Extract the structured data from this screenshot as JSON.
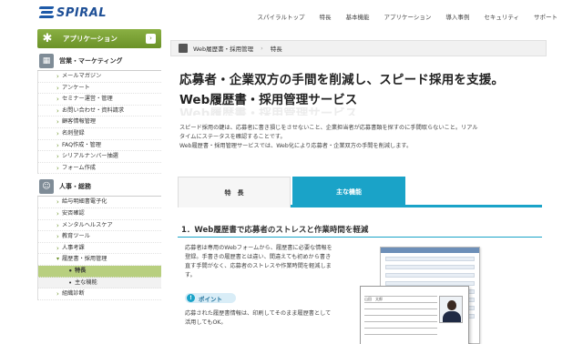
{
  "brand": {
    "name": "SPIRAL"
  },
  "topnav": [
    "スパイラルトップ",
    "特長",
    "基本機能",
    "アプリケーション",
    "導入事例",
    "セキュリティ",
    "サポート"
  ],
  "sidebar": {
    "app_title": "アプリケーション",
    "section1": {
      "title": "営業・マーケティング",
      "items": [
        "メールマガジン",
        "アンケート",
        "セミナー運営・管理",
        "お問い合わせ・資料請求",
        "顧客情報管理",
        "名刺登録",
        "FAQ作成・管理",
        "シリアルナンバー抽選",
        "フォーム作成"
      ]
    },
    "section2": {
      "title": "人事・総務",
      "items": [
        "給与明細書電子化",
        "安否確認",
        "メンタルヘルスケア",
        "教育ツール",
        "人事考課",
        "履歴書・採用管理"
      ],
      "subitems": [
        "特長",
        "主な機能"
      ],
      "after": [
        "組織診断"
      ]
    }
  },
  "breadcrumb": {
    "current": "Web履歴書・採用管理",
    "child": "特長"
  },
  "hero": {
    "line1": "応募者・企業双方の手間を削減し、スピード採用を支援。",
    "line2": "Web履歴書・採用管理サービス",
    "ghost": "Web履歴書・採用管理サービス"
  },
  "description": [
    "スピード採用の鍵は、応募者に書き損じをさせないこと、企業担当者が応募書類を探すのに手間取らないこと。リアル",
    "タイムにステータスを確認することです。",
    "Web履歴書・採用管理サービスでは、Web化により応募者・企業双方の手間を削減します。"
  ],
  "tabs": {
    "features": "特　長",
    "main_functions": "主な機能"
  },
  "section": {
    "title": "1．Web履歴書で応募者のストレスと作業時間を軽減",
    "body": [
      "応募者は専用のWebフォームから、履歴書に必要な情報を",
      "登録。手書きの履歴書とは違い、間違えても初めから書き",
      "直す手間がなく、応募者のストレスや作業時間を軽減しま",
      "す。"
    ],
    "point_label": "ポイント",
    "point_body": [
      "応募された履歴書情報は、印刷してそのまま履歴書として",
      "活用してもOK。"
    ]
  },
  "illustration": {
    "name_label": "山田　太郎"
  }
}
